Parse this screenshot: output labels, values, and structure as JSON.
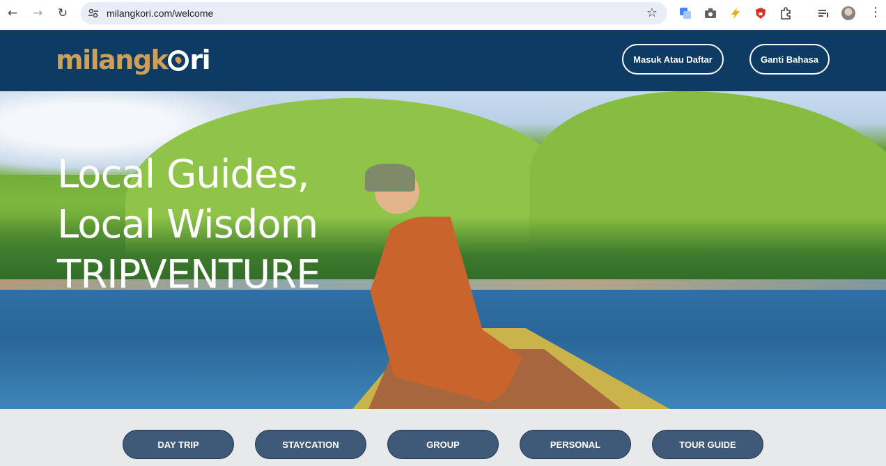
{
  "browser": {
    "url": "milangkori.com/welcome"
  },
  "header": {
    "logo_part1": "milangk",
    "logo_part2": "ri",
    "login_button": "Masuk Atau Daftar",
    "language_button": "Ganti Bahasa",
    "colors": {
      "background": "#0d3b63",
      "logo_gold": "#cf9f57"
    }
  },
  "hero": {
    "line1": "Local Guides,",
    "line2": "Local Wisdom",
    "line3": "TRIPVENTURE"
  },
  "categories": [
    {
      "label": "DAY TRIP"
    },
    {
      "label": "STAYCATION"
    },
    {
      "label": "GROUP"
    },
    {
      "label": "PERSONAL"
    },
    {
      "label": "TOUR GUIDE"
    }
  ],
  "category_color": "#3e5a78"
}
